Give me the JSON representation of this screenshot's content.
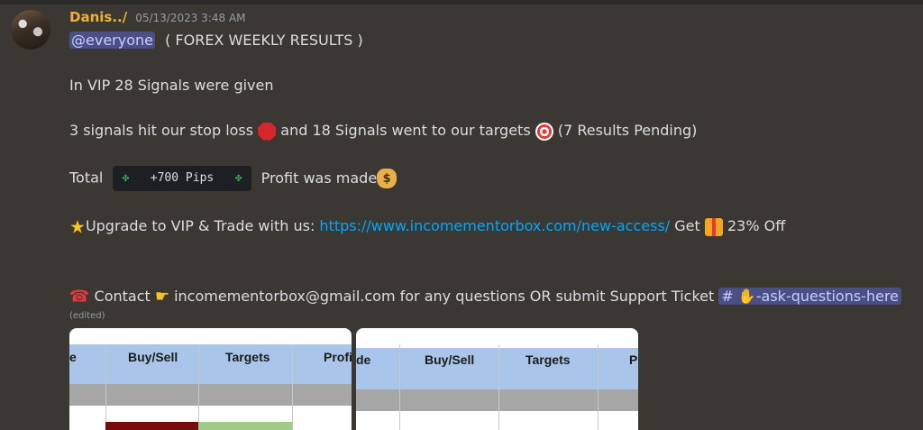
{
  "message": {
    "username": "Danis../",
    "timestamp": "05/13/2023 3:48 AM",
    "mention": "@everyone",
    "title": "( FOREX WEEKLY RESULTS )",
    "vip_line": "In VIP 28 Signals were given",
    "results": {
      "part1": "3 signals hit our stop loss",
      "part2": "and 18 Signals went to our targets",
      "part3": "(7 Results Pending)"
    },
    "total": {
      "prefix": "Total",
      "clover": "✤",
      "pips": "+700 Pips",
      "suffix": "Profit was made",
      "bag_symbol": "$"
    },
    "upgrade": {
      "text": "Upgrade to VIP & Trade with us:",
      "link": "https://www.incomementorbox.com/new-access/",
      "get": "Get",
      "discount": "23% Off"
    },
    "contact": {
      "text": "Contact",
      "email": "incomementorbox@gmail.com",
      "rest": "for any questions OR submit Support Ticket",
      "channel_hash": "#",
      "channel": "-ask-questions-here"
    },
    "edited": "(edited)"
  },
  "attachments": [
    {
      "headers": [
        "e",
        "Buy/Sell",
        "Targets",
        "Profi"
      ]
    },
    {
      "headers": [
        "de",
        "Buy/Sell",
        "Targets",
        "P"
      ]
    }
  ],
  "icons": [
    "avatar",
    "stop-sign-icon",
    "target-icon",
    "money-bag-icon",
    "star-icon",
    "gift-icon",
    "telephone-icon",
    "pointing-hand-icon",
    "raising-hand-icon"
  ]
}
